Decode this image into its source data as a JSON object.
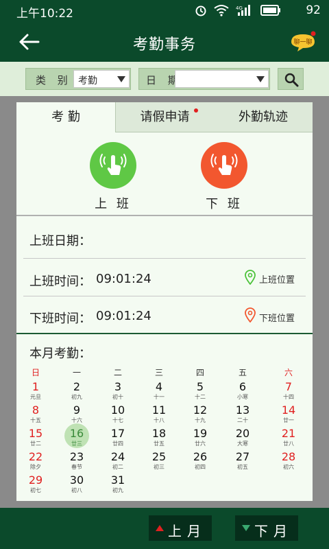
{
  "status_bar": {
    "time": "上午10:22",
    "battery": "92",
    "network": "4G"
  },
  "header": {
    "title": "考勤事务",
    "chat_badge": "聊一聊"
  },
  "filter": {
    "category_label": "类 别",
    "category_value": "考勤",
    "date_label": "日 期",
    "date_value": ""
  },
  "tabs": [
    {
      "label": "考 勤",
      "active": true
    },
    {
      "label": "请假申请",
      "active": false,
      "badge": true
    },
    {
      "label": "外勤轨迹",
      "active": false
    }
  ],
  "punch": {
    "on_label": "上 班",
    "off_label": "下 班",
    "on_color": "#5fc845",
    "off_color": "#f2572f"
  },
  "records": {
    "date_label": "上班日期：",
    "date_value": "",
    "on_time_label": "上班时间：",
    "on_time_value": "09:01:24",
    "on_location": "上班位置",
    "off_time_label": "下班时间：",
    "off_time_value": "09:01:24",
    "off_location": "下班位置"
  },
  "calendar": {
    "title": "本月考勤：",
    "weekdays": [
      "日",
      "一",
      "二",
      "三",
      "四",
      "五",
      "六"
    ],
    "today": 16,
    "days": [
      {
        "d": "1",
        "l": "元旦"
      },
      {
        "d": "2",
        "l": "初九"
      },
      {
        "d": "3",
        "l": "初十"
      },
      {
        "d": "4",
        "l": "十一"
      },
      {
        "d": "5",
        "l": "十二"
      },
      {
        "d": "6",
        "l": "小寒"
      },
      {
        "d": "7",
        "l": "十四"
      },
      {
        "d": "8",
        "l": "十五"
      },
      {
        "d": "9",
        "l": "十六"
      },
      {
        "d": "10",
        "l": "十七"
      },
      {
        "d": "11",
        "l": "十八"
      },
      {
        "d": "12",
        "l": "十九"
      },
      {
        "d": "13",
        "l": "二十"
      },
      {
        "d": "14",
        "l": "廿一"
      },
      {
        "d": "15",
        "l": "廿二"
      },
      {
        "d": "16",
        "l": "廿三"
      },
      {
        "d": "17",
        "l": "廿四"
      },
      {
        "d": "18",
        "l": "廿五"
      },
      {
        "d": "19",
        "l": "廿六"
      },
      {
        "d": "20",
        "l": "大寒"
      },
      {
        "d": "21",
        "l": "廿八"
      },
      {
        "d": "22",
        "l": "除夕"
      },
      {
        "d": "23",
        "l": "春节"
      },
      {
        "d": "24",
        "l": "初二"
      },
      {
        "d": "25",
        "l": "初三"
      },
      {
        "d": "26",
        "l": "初四"
      },
      {
        "d": "27",
        "l": "初五"
      },
      {
        "d": "28",
        "l": "初六"
      },
      {
        "d": "29",
        "l": "初七"
      },
      {
        "d": "30",
        "l": "初八"
      },
      {
        "d": "31",
        "l": "初九"
      }
    ]
  },
  "nav": {
    "prev_label": "上月",
    "next_label": "下月"
  },
  "colors": {
    "primary_dark": "#0b4a2b",
    "accent_red": "#e02020"
  }
}
